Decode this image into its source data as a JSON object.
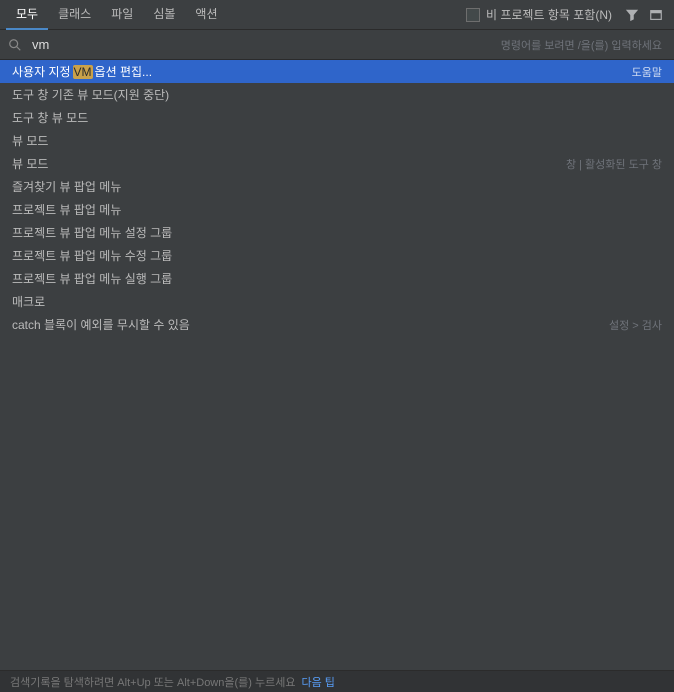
{
  "tabs": {
    "items": [
      {
        "label": "모두",
        "active": true
      },
      {
        "label": "클래스",
        "active": false
      },
      {
        "label": "파일",
        "active": false
      },
      {
        "label": "심볼",
        "active": false
      },
      {
        "label": "액션",
        "active": false
      }
    ],
    "checkbox_label": "비 프로젝트 항목 포함(N)"
  },
  "search": {
    "value": "vm",
    "hint": "명령어를 보려면 /을(를) 입력하세요"
  },
  "results": [
    {
      "pre": "사용자 지정 ",
      "hl": "VM",
      "post": " 옵션 편집...",
      "meta": "도움말",
      "selected": true
    },
    {
      "pre": "도구 창 기존 뷰 모드(지원 중단)",
      "hl": "",
      "post": "",
      "meta": "",
      "selected": false
    },
    {
      "pre": "도구 창 뷰 모드",
      "hl": "",
      "post": "",
      "meta": "",
      "selected": false
    },
    {
      "pre": "뷰 모드",
      "hl": "",
      "post": "",
      "meta": "",
      "selected": false
    },
    {
      "pre": "뷰 모드",
      "hl": "",
      "post": "",
      "meta": "창 | 활성화된 도구 창",
      "selected": false
    },
    {
      "pre": "즐겨찾기 뷰 팝업 메뉴",
      "hl": "",
      "post": "",
      "meta": "",
      "selected": false
    },
    {
      "pre": "프로젝트 뷰 팝업 메뉴",
      "hl": "",
      "post": "",
      "meta": "",
      "selected": false
    },
    {
      "pre": "프로젝트 뷰 팝업 메뉴 설정 그룹",
      "hl": "",
      "post": "",
      "meta": "",
      "selected": false
    },
    {
      "pre": "프로젝트 뷰 팝업 메뉴 수정 그룹",
      "hl": "",
      "post": "",
      "meta": "",
      "selected": false
    },
    {
      "pre": "프로젝트 뷰 팝업 메뉴 실행 그룹",
      "hl": "",
      "post": "",
      "meta": "",
      "selected": false
    },
    {
      "pre": "매크로",
      "hl": "",
      "post": "",
      "meta": "",
      "selected": false
    },
    {
      "pre": "catch 블록이 예외를 무시할 수 있음",
      "hl": "",
      "post": "",
      "meta": "설정 > 검사",
      "selected": false
    }
  ],
  "footer": {
    "text": "검색기록을 탐색하려면 Alt+Up 또는 Alt+Down을(를) 누르세요",
    "link": "다음 팁"
  }
}
